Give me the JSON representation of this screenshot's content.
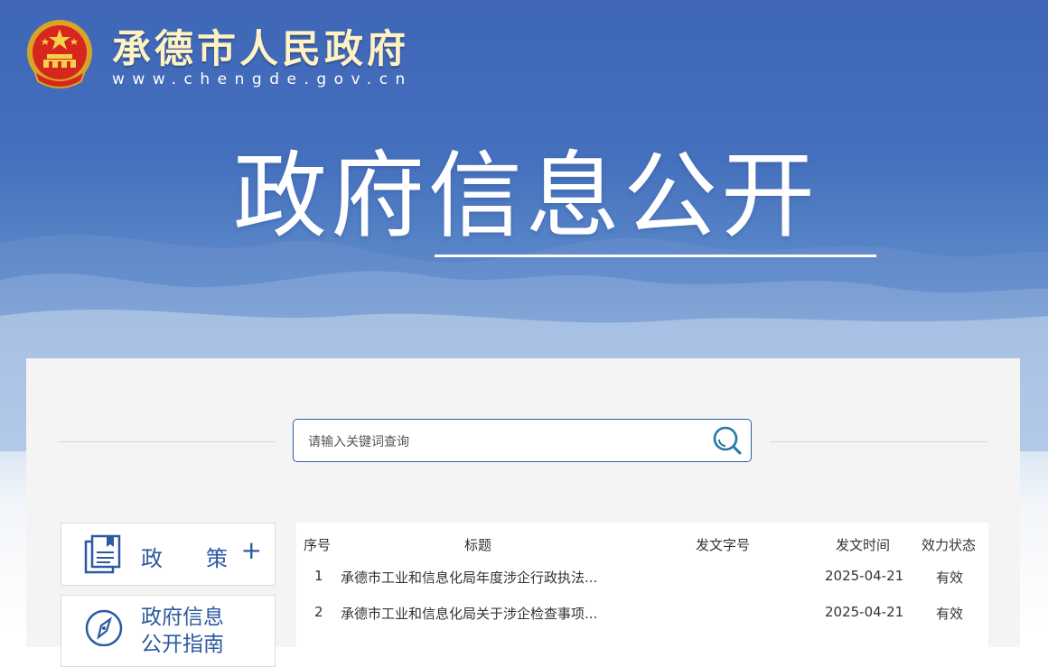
{
  "header": {
    "site_name": "承德市人民政府",
    "site_url": "www.chengde.gov.cn"
  },
  "banner": {
    "title": "政府信息公开"
  },
  "search": {
    "placeholder": "请输入关键词查询",
    "icon": "search-icon"
  },
  "sidebar": {
    "items": [
      {
        "label": "政　　策",
        "icon": "document-icon",
        "expand": "+"
      },
      {
        "label": "政府信息",
        "label2": "公开指南",
        "icon": "compass-icon"
      }
    ]
  },
  "table": {
    "headers": [
      "序号",
      "标题",
      "发文字号",
      "发文时间",
      "效力状态"
    ],
    "rows": [
      {
        "no": "1",
        "title": "承德市工业和信息化局年度涉企行政执法...",
        "doc_no": "",
        "date": "2025-04-21",
        "status": "有效"
      },
      {
        "no": "2",
        "title": "承德市工业和信息化局关于涉企检查事项...",
        "doc_no": "",
        "date": "2025-04-21",
        "status": "有效"
      }
    ]
  },
  "colors": {
    "brand_blue": "#2c5aa0",
    "header_gold": "#fff3c4"
  }
}
